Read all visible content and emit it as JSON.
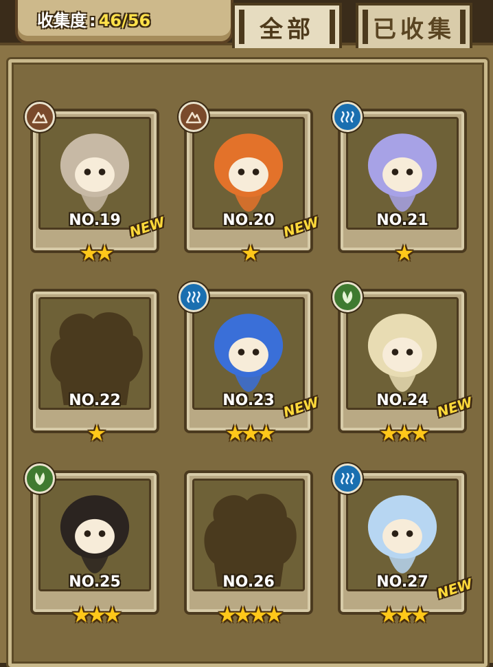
{
  "header": {
    "collect_label": "收集度",
    "collect_colon": ":",
    "collect_count": "46/56"
  },
  "tabs": [
    {
      "label": "全部",
      "active": true
    },
    {
      "label": "已收集",
      "active": false
    }
  ],
  "cards": [
    {
      "number": "NO.19",
      "stars": "★★",
      "element": "earth",
      "new": "NEW",
      "silhouette": false,
      "art_color": "#c7b9a5"
    },
    {
      "number": "NO.20",
      "stars": "★",
      "element": "earth",
      "new": "NEW",
      "silhouette": false,
      "art_color": "#e3722a"
    },
    {
      "number": "NO.21",
      "stars": "★",
      "element": "water",
      "new": "",
      "silhouette": false,
      "art_color": "#a7a2e6"
    },
    {
      "number": "NO.22",
      "stars": "★",
      "element": "",
      "new": "",
      "silhouette": true,
      "art_color": "#4a3a1e"
    },
    {
      "number": "NO.23",
      "stars": "★★★",
      "element": "water",
      "new": "NEW",
      "silhouette": false,
      "art_color": "#3a6fd8"
    },
    {
      "number": "NO.24",
      "stars": "★★★",
      "element": "wood",
      "new": "NEW",
      "silhouette": false,
      "art_color": "#e8dcb3"
    },
    {
      "number": "NO.25",
      "stars": "★★★",
      "element": "wood",
      "new": "",
      "silhouette": false,
      "art_color": "#2b2420"
    },
    {
      "number": "NO.26",
      "stars": "★★★★",
      "element": "",
      "new": "",
      "silhouette": true,
      "art_color": "#4a3a1e"
    },
    {
      "number": "NO.27",
      "stars": "★★★",
      "element": "water",
      "new": "NEW",
      "silhouette": false,
      "art_color": "#b7d6f2"
    }
  ]
}
